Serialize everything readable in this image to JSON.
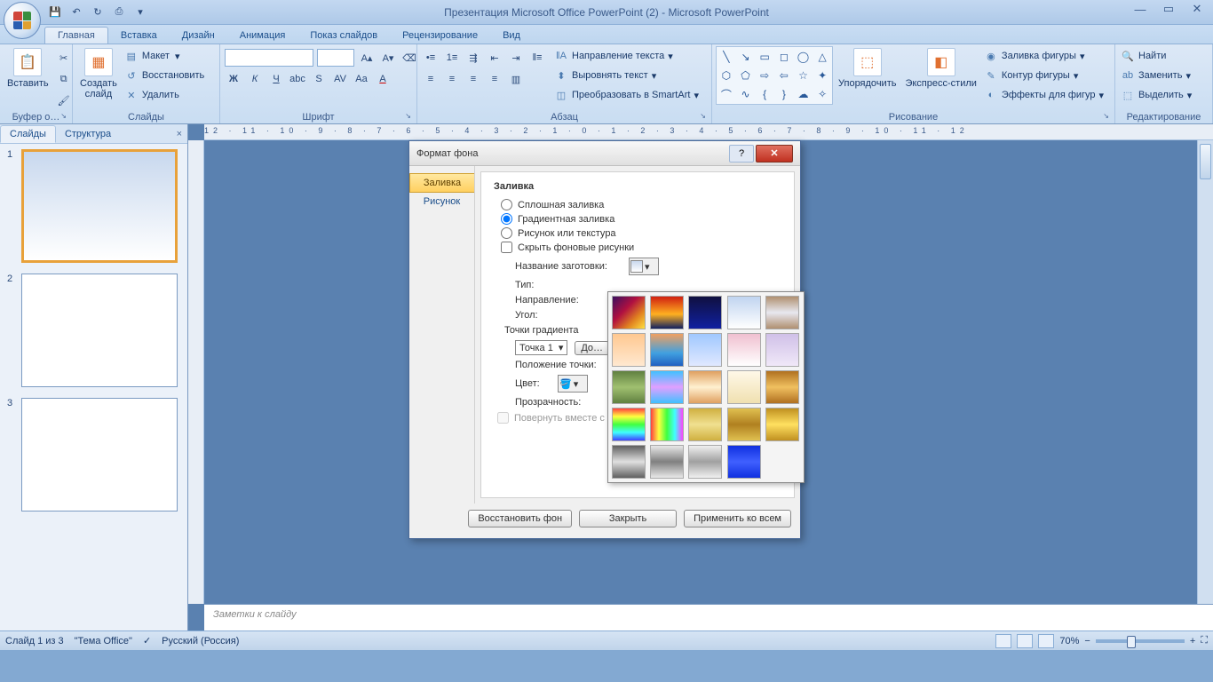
{
  "app_title": "Презентация Microsoft Office PowerPoint (2) - Microsoft PowerPoint",
  "ribbon": {
    "tabs": [
      "Главная",
      "Вставка",
      "Дизайн",
      "Анимация",
      "Показ слайдов",
      "Рецензирование",
      "Вид"
    ],
    "active_tab": 0,
    "groups": {
      "clipboard": {
        "label": "Буфер о…",
        "paste": "Вставить"
      },
      "slides": {
        "label": "Слайды",
        "new": "Создать\nслайд",
        "layout": "Макет",
        "reset": "Восстановить",
        "delete": "Удалить"
      },
      "font": {
        "label": "Шрифт"
      },
      "paragraph": {
        "label": "Абзац",
        "text_direction": "Направление текста",
        "align_text": "Выровнять текст",
        "smartart": "Преобразовать в SmartArt"
      },
      "drawing": {
        "label": "Рисование",
        "arrange": "Упорядочить",
        "styles": "Экспресс-стили",
        "fill": "Заливка фигуры",
        "outline": "Контур фигуры",
        "effects": "Эффекты для фигур"
      },
      "editing": {
        "label": "Редактирование",
        "find": "Найти",
        "replace": "Заменить",
        "select": "Выделить"
      }
    }
  },
  "panel": {
    "tabs": [
      "Слайды",
      "Структура"
    ],
    "active": 0,
    "slide_nums": [
      "1",
      "2",
      "3"
    ]
  },
  "ruler_h": "12 · 11 · 10 · 9 · 8 · 7 · 6 · 5 · 4 · 3 · 2 · 1 · 0 · 1 · 2 · 3 · 4 · 5 · 6 · 7 · 8 · 9 · 10 · 11 · 12",
  "notes": "Заметки к слайду",
  "status": {
    "slide": "Слайд 1 из 3",
    "theme": "\"Тема Office\"",
    "lang": "Русский (Россия)",
    "zoom": "70%"
  },
  "dialog": {
    "title": "Формат фона",
    "nav": [
      "Заливка",
      "Рисунок"
    ],
    "nav_active": 0,
    "heading": "Заливка",
    "radios": [
      "Сплошная заливка",
      "Градиентная заливка",
      "Рисунок или текстура"
    ],
    "radio_selected": 1,
    "hide_bg": "Скрыть фоновые рисунки",
    "fields": {
      "preset": "Название заготовки:",
      "type": "Тип:",
      "direction": "Направление:",
      "angle": "Угол:",
      "stops_header": "Точки градиента",
      "stop_value": "Точка 1",
      "add_stop": "До…",
      "position": "Положение точки:",
      "color": "Цвет:",
      "transparency": "Прозрачность:"
    },
    "rotate_with_shape": "Повернуть вместе с фигурой",
    "buttons": {
      "reset": "Восстановить фон",
      "close": "Закрыть",
      "apply_all": "Применить ко всем"
    }
  }
}
